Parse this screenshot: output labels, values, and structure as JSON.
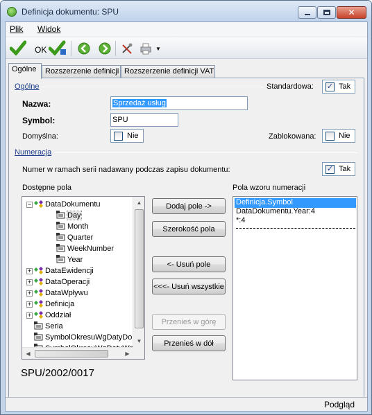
{
  "window": {
    "title": "Definicja dokumentu: SPU"
  },
  "menu": {
    "items": [
      "Plik",
      "Widok"
    ]
  },
  "toolbar": {
    "ok_label": "OK"
  },
  "tabs": [
    "Ogólne",
    "Rozszerzenie definicji",
    "Rozszerzenie definicji VAT"
  ],
  "general": {
    "section_label": "Ogólne",
    "standard_label": "Standardowa:",
    "standard_value": "Tak",
    "standard_checked": true,
    "name_label": "Nazwa:",
    "name_value": "Sprzedaż usług",
    "symbol_label": "Symbol:",
    "symbol_value": "SPU",
    "default_label": "Domyślna:",
    "default_value": "Nie",
    "blocked_label": "Zablokowana:",
    "blocked_value": "Nie"
  },
  "numbering": {
    "section_label": "Numeracja",
    "serial_text": "Numer w ramach serii nadawany podczas zapisu dokumentu:",
    "serial_value": "Tak",
    "serial_checked": true,
    "available_label": "Dostępne pola",
    "pattern_label": "Pola wzoru numeracji",
    "tree": [
      {
        "label": "DataDokumentu",
        "level": 0,
        "expander": "−"
      },
      {
        "label": "Day",
        "level": 1,
        "expander": ""
      },
      {
        "label": "Month",
        "level": 1,
        "expander": ""
      },
      {
        "label": "Quarter",
        "level": 1,
        "expander": ""
      },
      {
        "label": "WeekNumber",
        "level": 1,
        "expander": ""
      },
      {
        "label": "Year",
        "level": 1,
        "expander": ""
      },
      {
        "label": "DataEwidencji",
        "level": 0,
        "expander": "+"
      },
      {
        "label": "DataOperacji",
        "level": 0,
        "expander": "+"
      },
      {
        "label": "DataWpływu",
        "level": 0,
        "expander": "+"
      },
      {
        "label": "Definicja",
        "level": 0,
        "expander": "+"
      },
      {
        "label": "Oddział",
        "level": 0,
        "expander": "+"
      },
      {
        "label": "Seria",
        "level": 0,
        "expander": ""
      },
      {
        "label": "SymbolOkresuWgDatyDo",
        "level": 0,
        "expander": ""
      },
      {
        "label": "SymbolOkresuWgDatyWp",
        "level": 0,
        "expander": ""
      }
    ],
    "buttons": {
      "add": "Dodaj pole ->",
      "width": "Szerokość pola",
      "remove": "<- Usuń pole",
      "remove_all": "<<<- Usuń wszystkie",
      "move_up": "Przenieś w górę",
      "move_down": "Przenieś w dół"
    },
    "pattern_items": [
      "Definicja.Symbol",
      "DataDokumentu.Year:4",
      "*:4"
    ],
    "preview": "SPU/2002/0017"
  },
  "status": {
    "preview_label": "Podgląd"
  }
}
